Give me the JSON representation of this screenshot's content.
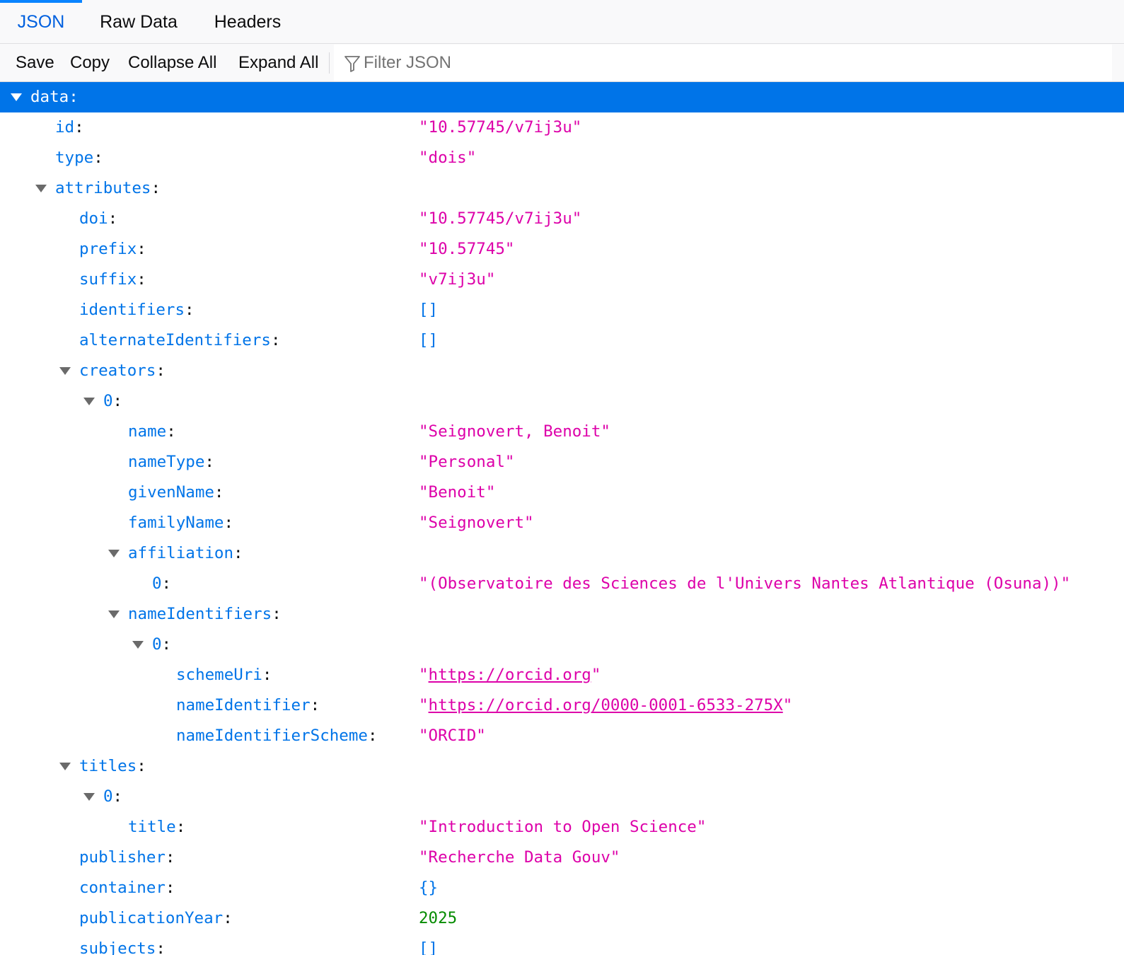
{
  "tabs": [
    {
      "label": "JSON",
      "active": true
    },
    {
      "label": "Raw Data",
      "active": false
    },
    {
      "label": "Headers",
      "active": false
    }
  ],
  "toolbar": {
    "save_label": "Save",
    "copy_label": "Copy",
    "collapse_label": "Collapse All",
    "expand_label": "Expand All",
    "filter_placeholder": "Filter JSON",
    "filter_icon": "filter-icon"
  },
  "colors": {
    "accent": "#0a84ff",
    "selected_row": "#0074e8",
    "key": "#0074e8",
    "string": "#dd00a9",
    "number": "#058b00"
  },
  "tree": {
    "data_key": "data",
    "id": {
      "key": "id",
      "value": "\"10.57745/v7ij3u\""
    },
    "type": {
      "key": "type",
      "value": "\"dois\""
    },
    "attributes_key": "attributes",
    "doi": {
      "key": "doi",
      "value": "\"10.57745/v7ij3u\""
    },
    "prefix": {
      "key": "prefix",
      "value": "\"10.57745\""
    },
    "suffix": {
      "key": "suffix",
      "value": "\"v7ij3u\""
    },
    "identifiers": {
      "key": "identifiers",
      "value": "[]"
    },
    "alternateIdentifiers": {
      "key": "alternateIdentifiers",
      "value": "[]"
    },
    "creators_key": "creators",
    "creator0_key": "0",
    "name": {
      "key": "name",
      "value": "\"Seignovert, Benoit\""
    },
    "nameType": {
      "key": "nameType",
      "value": "\"Personal\""
    },
    "givenName": {
      "key": "givenName",
      "value": "\"Benoit\""
    },
    "familyName": {
      "key": "familyName",
      "value": "\"Seignovert\""
    },
    "affiliation_key": "affiliation",
    "affiliation0": {
      "key": "0",
      "value": "\"(Observatoire des Sciences de l'Univers Nantes Atlantique (Osuna))\""
    },
    "nameIdentifiers_key": "nameIdentifiers",
    "nameIdentifiers0_key": "0",
    "schemeUri": {
      "key": "schemeUri",
      "quote": "\"",
      "link": "https://orcid.org"
    },
    "nameIdentifier": {
      "key": "nameIdentifier",
      "quote": "\"",
      "link": "https://orcid.org/0000-0001-6533-275X"
    },
    "nameIdentifierScheme": {
      "key": "nameIdentifierScheme",
      "value": "\"ORCID\""
    },
    "titles_key": "titles",
    "titles0_key": "0",
    "title": {
      "key": "title",
      "value": "\"Introduction to Open Science\""
    },
    "publisher": {
      "key": "publisher",
      "value": "\"Recherche Data Gouv\""
    },
    "container": {
      "key": "container",
      "value": "{}"
    },
    "publicationYear": {
      "key": "publicationYear",
      "value": "2025"
    },
    "subjects": {
      "key": "subjects",
      "value": "[]"
    }
  }
}
